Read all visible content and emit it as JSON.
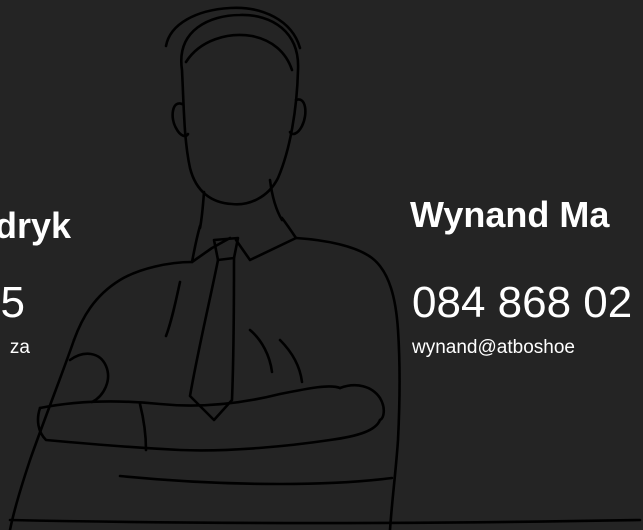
{
  "colors": {
    "background": "#242424",
    "text": "#ffffff",
    "line_art": "#000000"
  },
  "contacts": [
    {
      "name": "dryk",
      "phone": "5",
      "email": "za"
    },
    {
      "name": "Wynand Ma",
      "phone": "084 868 02",
      "email": "wynand@atboshoe"
    }
  ],
  "illustration": {
    "icon": "businessman-arms-crossed-line-art"
  }
}
